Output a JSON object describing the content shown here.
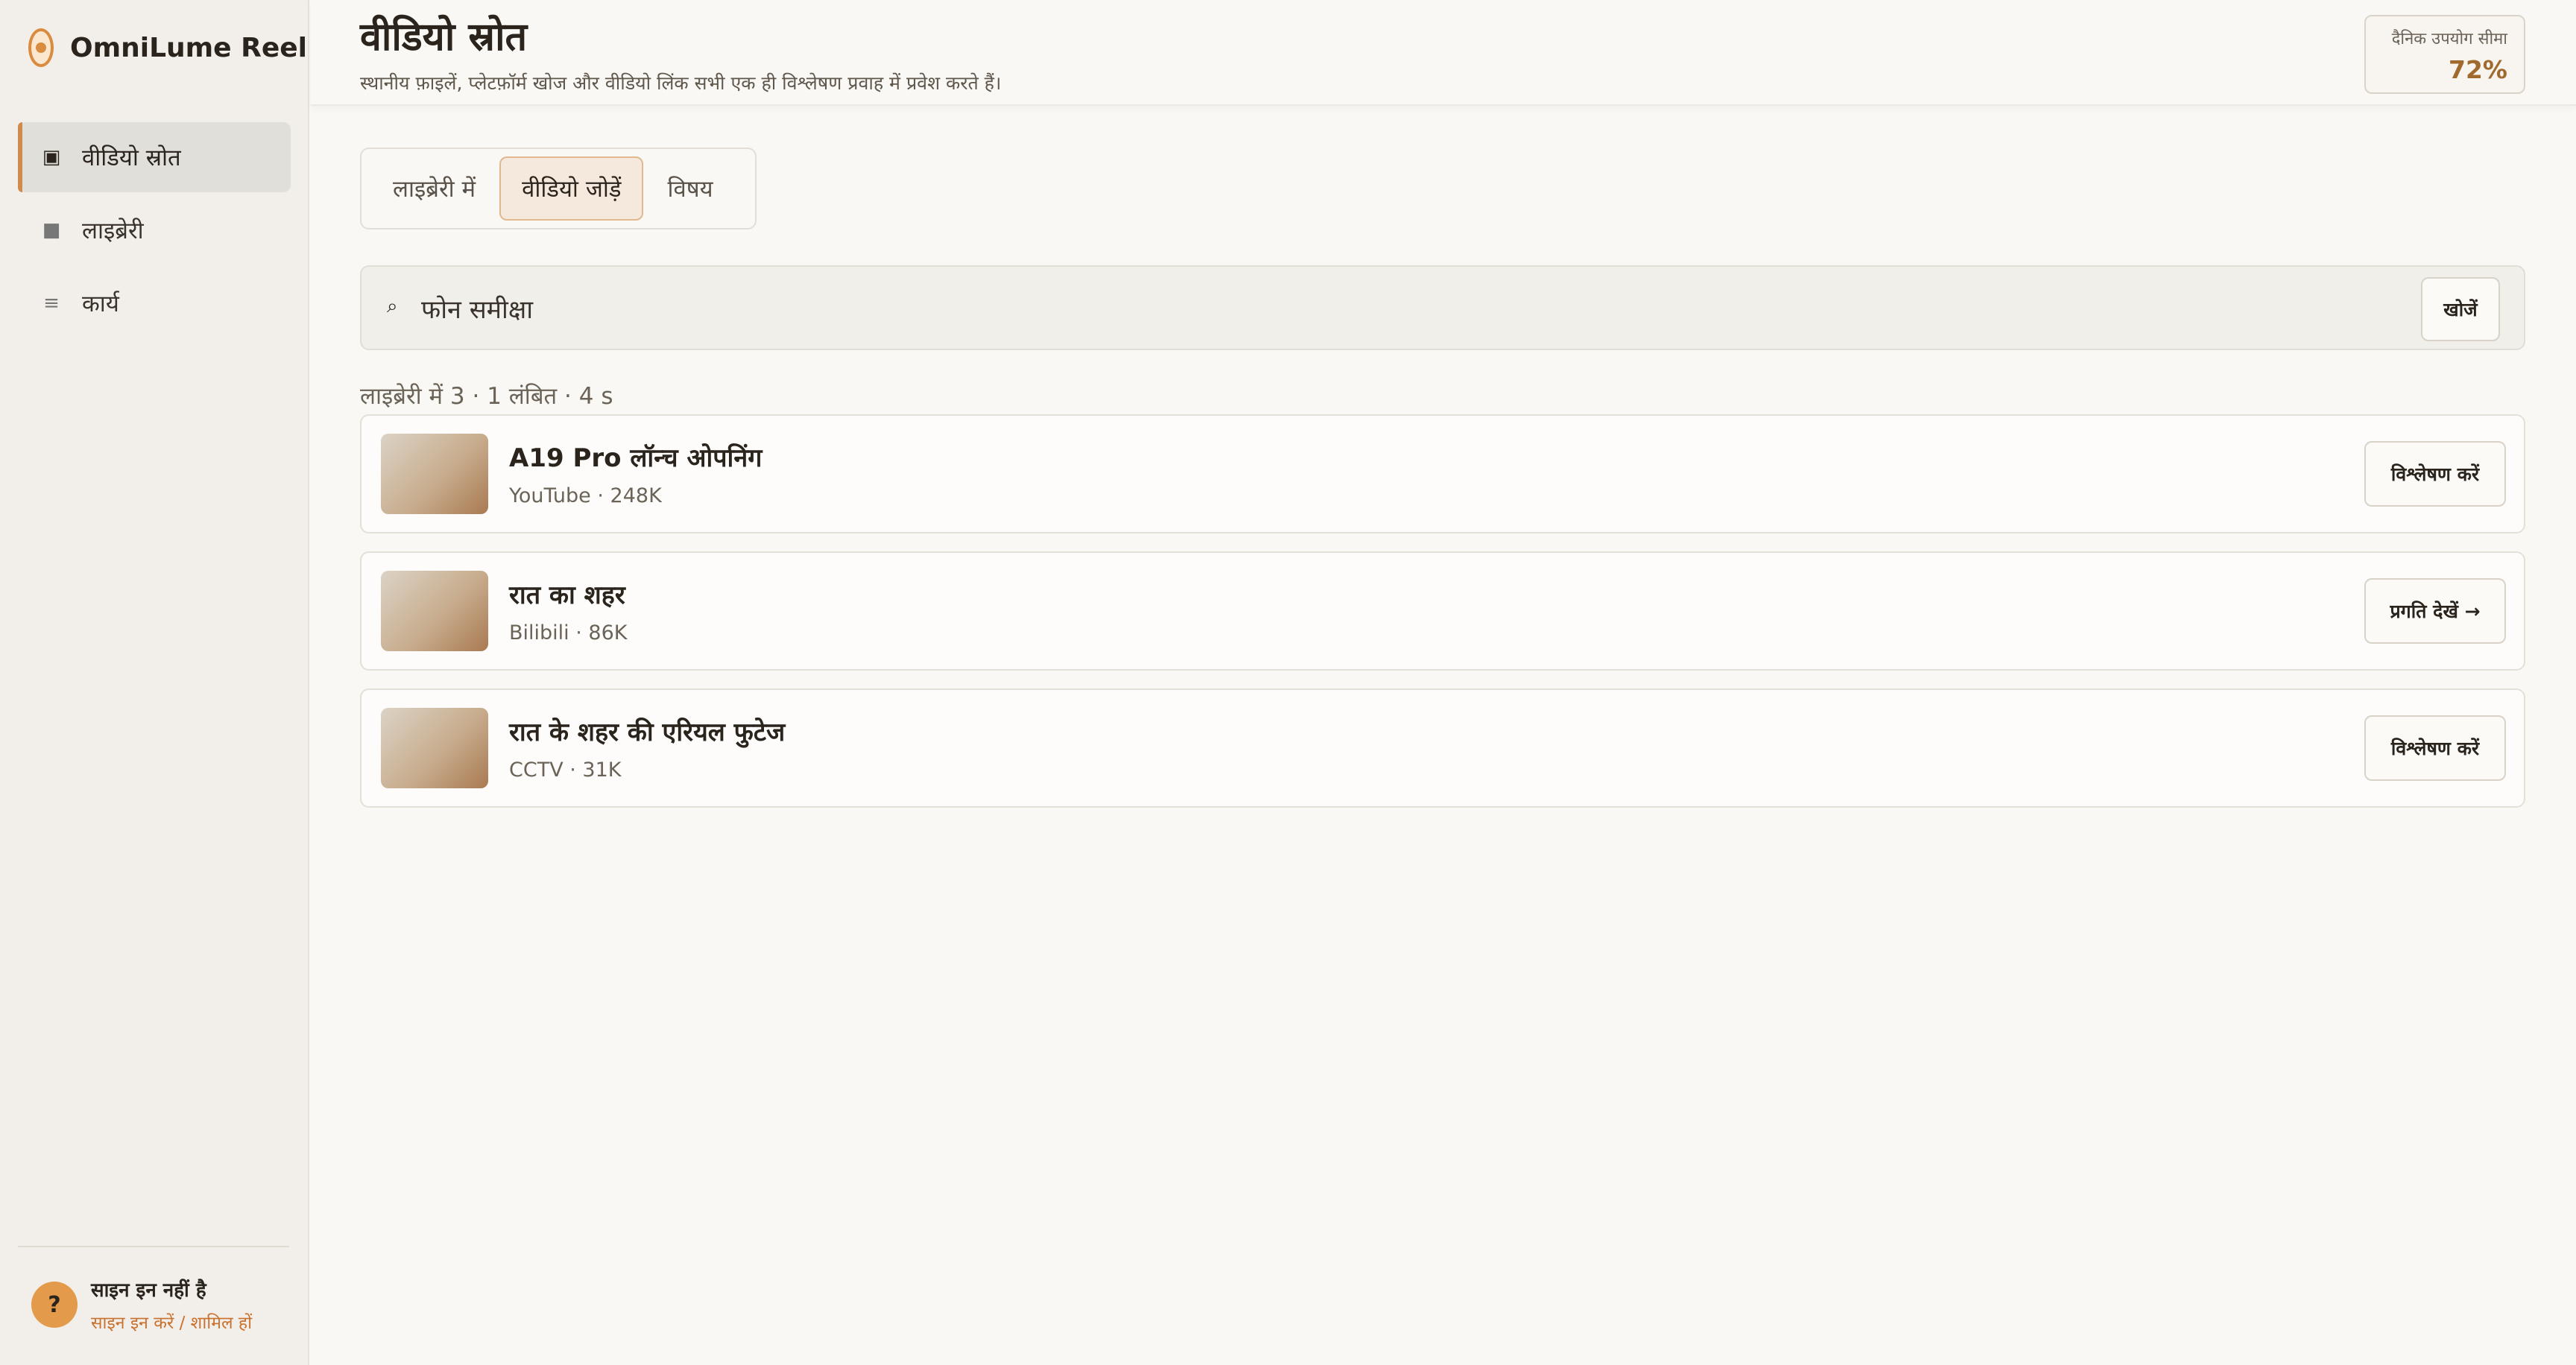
{
  "app": {
    "name": "OmniLume Reel"
  },
  "sidebar": {
    "items": [
      {
        "label": "वीडियो स्रोत",
        "icon": "square-icon",
        "glyph": "▣",
        "active": true
      },
      {
        "label": "लाइब्रेरी",
        "icon": "library-icon",
        "glyph": "■",
        "active": false
      },
      {
        "label": "कार्य",
        "icon": "tasks-icon",
        "glyph": "≡",
        "active": false
      }
    ],
    "user": {
      "avatar": "?",
      "title": "साइन इन नहीं है",
      "link": "साइन इन करें / शामिल हों"
    }
  },
  "header": {
    "title": "वीडियो स्रोत",
    "subtitle": "स्थानीय फ़ाइलें, प्लेटफ़ॉर्म खोज और वीडियो लिंक सभी एक ही विश्लेषण प्रवाह में प्रवेश करते हैं।",
    "usage_label": "दैनिक उपयोग सीमा",
    "usage_value": "72%"
  },
  "tabs": [
    {
      "label": "लाइब्रेरी में",
      "active": false
    },
    {
      "label": "वीडियो जोड़ें",
      "active": true
    },
    {
      "label": "विषय",
      "active": false
    }
  ],
  "search": {
    "icon": "⌕",
    "value": "फोन समीक्षा",
    "button_label": "खोजें"
  },
  "summary": "लाइब्रेरी में 3 · 1 लंबित · 4 s",
  "videos": [
    {
      "title": "A19 Pro लॉन्च ओपनिंग",
      "meta": "YouTube · 248K",
      "action": "विश्लेषण करें"
    },
    {
      "title": "रात का शहर",
      "meta": "Bilibili · 86K",
      "action": "प्रगति देखें →"
    },
    {
      "title": "रात के शहर की एरियल फुटेज",
      "meta": "CCTV · 31K",
      "action": "विश्लेषण करें"
    }
  ],
  "colors": {
    "accent": "#d08a4a",
    "usage_value": "#a06a2e",
    "link": "#c9722f",
    "avatar": "#e39a4b",
    "background": "#faf8f4"
  }
}
